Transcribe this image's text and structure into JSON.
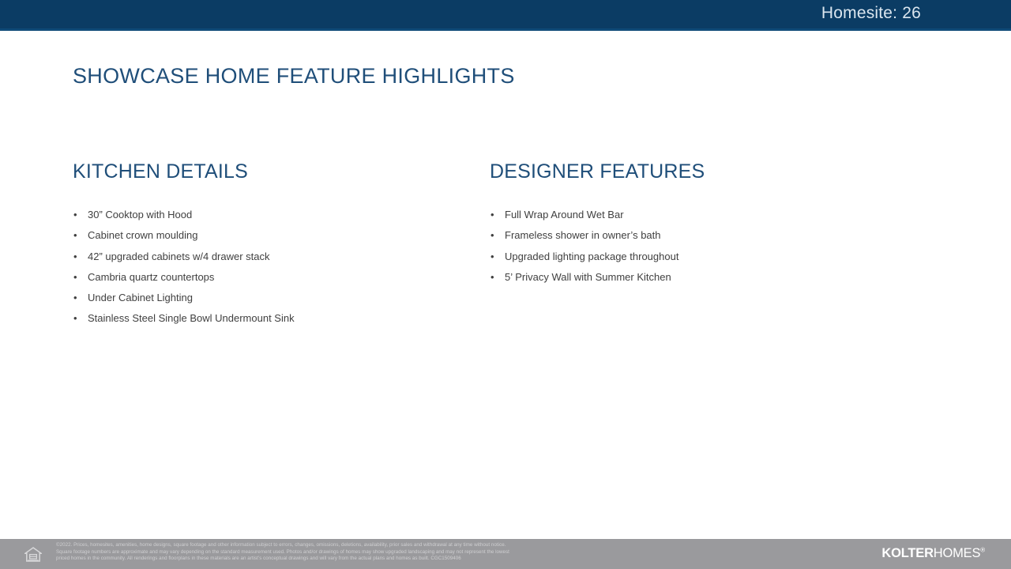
{
  "header": {
    "homesite_label": "Homesite: 26",
    "bar_color": "#0b3c64"
  },
  "slide": {
    "title": "SHOWCASE HOME FEATURE HIGHLIGHTS",
    "title_color": "#1f4e79"
  },
  "columns": {
    "left": {
      "heading": "KITCHEN DETAILS",
      "items": [
        "30” Cooktop with Hood",
        "Cabinet crown moulding",
        "42” upgraded cabinets w/4 drawer stack",
        "Cambria quartz countertops",
        "Under Cabinet Lighting",
        "Stainless Steel Single Bowl Undermount Sink"
      ]
    },
    "right": {
      "heading": "DESIGNER FEATURES",
      "items": [
        "Full Wrap Around Wet Bar",
        "Frameless shower in owner’s bath",
        "Upgraded lighting package throughout",
        "5’ Privacy Wall with Summer Kitchen"
      ]
    }
  },
  "footer": {
    "bar_color": "#9a9a9d",
    "disclaimer_lines": [
      "©2022. Prices, homesites, amenities, home designs, square footage and other information subject to errors, changes, omissions, deletions, availability, prior sales and withdrawal at any time without notice.",
      "Square footage numbers are approximate and may vary depending on the standard measurement used. Photos and/or drawings of homes may show upgraded landscaping and may not represent the lowest",
      "priced homes in the community. All renderings and floorplans in these materials are an artist’s conceptual drawings and will vary from the actual plans and homes as built. CGC1509406"
    ],
    "logo": {
      "bold_part": "KOLTER",
      "light_part": "HOMES",
      "registered_mark": "®"
    },
    "eho_icon_name": "equal-housing-opportunity-icon"
  }
}
